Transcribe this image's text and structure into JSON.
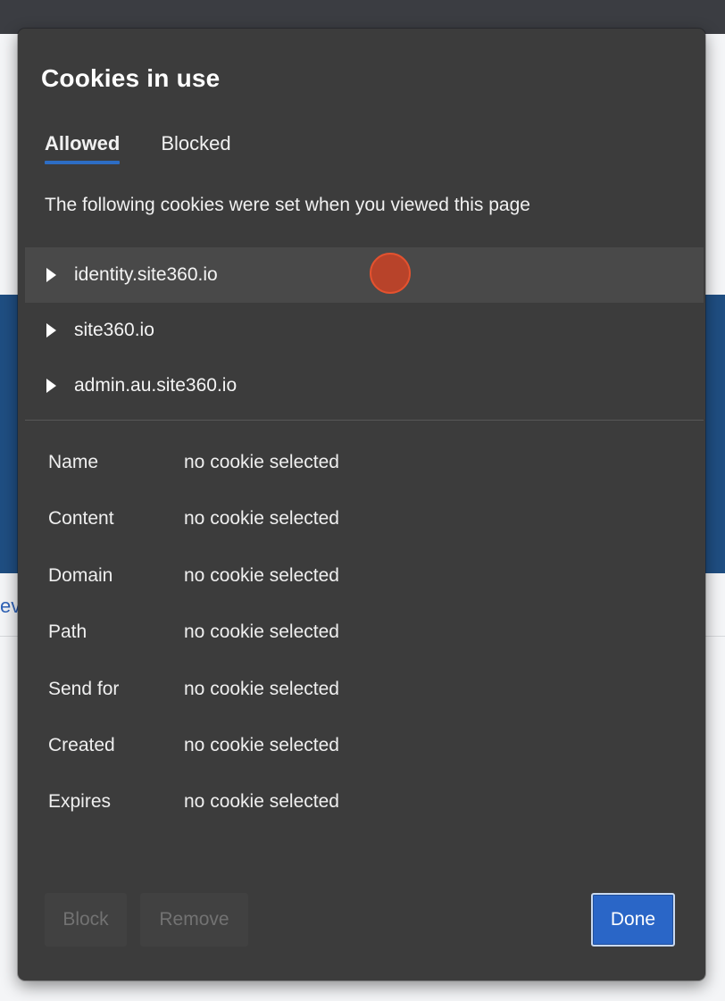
{
  "dialog": {
    "title": "Cookies in use",
    "tabs": [
      {
        "label": "Allowed",
        "active": true
      },
      {
        "label": "Blocked",
        "active": false
      }
    ],
    "subtitle": "The following cookies were set when you viewed this page",
    "domains": [
      {
        "label": "identity.site360.io"
      },
      {
        "label": "site360.io"
      },
      {
        "label": "admin.au.site360.io"
      }
    ],
    "details": [
      {
        "key": "Name",
        "value": "no cookie selected"
      },
      {
        "key": "Content",
        "value": "no cookie selected"
      },
      {
        "key": "Domain",
        "value": "no cookie selected"
      },
      {
        "key": "Path",
        "value": "no cookie selected"
      },
      {
        "key": "Send for",
        "value": "no cookie selected"
      },
      {
        "key": "Created",
        "value": "no cookie selected"
      },
      {
        "key": "Expires",
        "value": "no cookie selected"
      }
    ],
    "buttons": {
      "block": "Block",
      "remove": "Remove",
      "done": "Done"
    }
  },
  "background": {
    "link_fragment": "ev"
  },
  "colors": {
    "dialog_bg": "#3c3c3c",
    "accent": "#2a66c7",
    "hover_row": "#494949",
    "cursor_marker": "#b8432a"
  },
  "icons": {
    "expand": "triangle-right-icon",
    "cursor": "click-indicator"
  }
}
